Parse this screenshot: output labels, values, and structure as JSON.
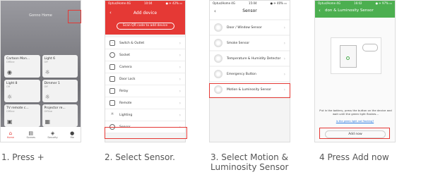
{
  "captions": [
    "1. Press +",
    "2. Select Sensor.",
    "3. Select Motion & Luminosity Sensor",
    "4 Press Add now"
  ],
  "p1": {
    "title": "Gonno Home",
    "cards": [
      {
        "name": "Cartoon Mon...",
        "status": "Offline",
        "icon": "camera-icon"
      },
      {
        "name": "Light 6",
        "status": "Off",
        "icon": "bulb-icon"
      },
      {
        "name": "Light 8",
        "status": "Off",
        "icon": "bulb-icon"
      },
      {
        "name": "Dimmer 1",
        "status": "Off",
        "icon": "bulb-icon"
      },
      {
        "name": "TV remote c...",
        "status": "Offline",
        "icon": "tv-icon"
      },
      {
        "name": "Projector re...",
        "status": "Offline",
        "icon": "remote-icon"
      }
    ],
    "nav": [
      "Home",
      "Scenes",
      "Security",
      "Me"
    ]
  },
  "p2": {
    "status_left": "Optus/Home 4G",
    "status_time": "10:04",
    "status_right": "● ✈ 42% ▭",
    "title": "Add device",
    "qr_label": "Scan QR code to add device",
    "items": [
      "Switch & Outlet",
      "Socket",
      "Camera",
      "Door Lock",
      "Relay",
      "Remote",
      "Lighting",
      "Sensor"
    ]
  },
  "p3": {
    "status_left": "Optus/Home 4G",
    "status_time": "15:04",
    "status_right": "● ✈ 40% ▭",
    "title": "Sensor",
    "items": [
      "Door / Window Sensor",
      "Smoke Sensor",
      "Temperature & Humidity Detector",
      "Emergency Button",
      "Motion & Luminosity Sensor"
    ]
  },
  "p4": {
    "status_left": "Optus/Home 4G",
    "status_time": "16:02",
    "status_right": "● ✈ 97% ▭",
    "title": "don & Luminosity Sensor",
    "instruction": "Put in the battery, press the button on the device and wait until the green light flashes...",
    "link": "Is the green light not flashing?",
    "button": "Add now"
  }
}
